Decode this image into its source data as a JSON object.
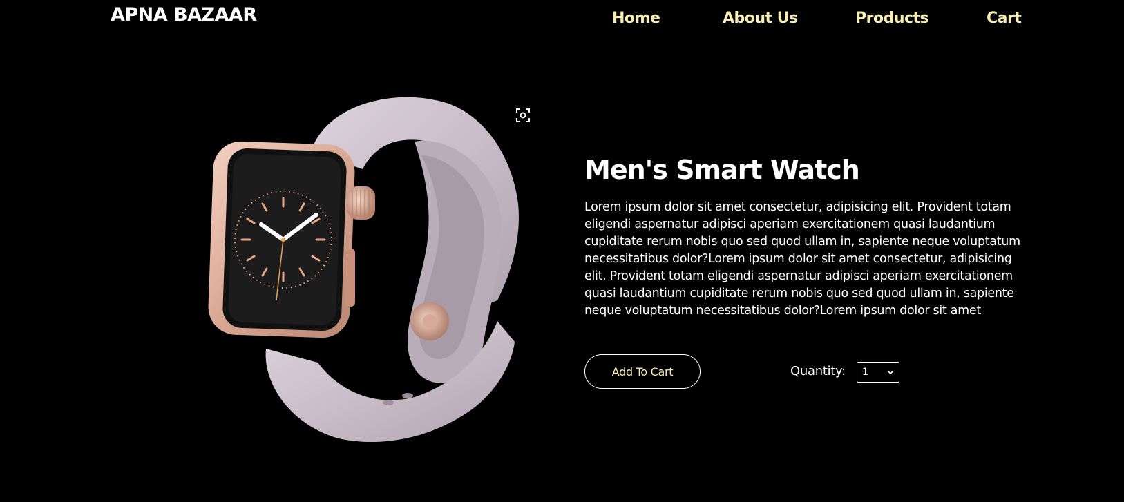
{
  "header": {
    "brand": "APNA BAZAAR",
    "nav": [
      {
        "label": "Home"
      },
      {
        "label": "About Us"
      },
      {
        "label": "Products"
      },
      {
        "label": "Cart"
      }
    ]
  },
  "product": {
    "image_icon": "smart-watch-image",
    "lens_icon": "image-search-icon",
    "title": "Men's Smart Watch",
    "description": "Lorem ipsum dolor sit amet consectetur, adipisicing elit. Provident totam eligendi aspernatur adipisci aperiam exercitationem quasi laudantium cupiditate rerum nobis quo sed quod ullam in, sapiente neque voluptatum necessitatibus dolor?Lorem ipsum dolor sit amet consectetur, adipisicing elit. Provident totam eligendi aspernatur adipisci aperiam exercitationem quasi laudantium cupiditate rerum nobis quo sed quod ullam in, sapiente neque voluptatum necessitatibus dolor?Lorem ipsum dolor sit amet",
    "add_to_cart_label": "Add To Cart",
    "quantity_label": "Quantity:",
    "quantity_value": "1"
  },
  "colors": {
    "background": "#000000",
    "nav_accent": "#f8eeb3",
    "text": "#ffffff"
  }
}
